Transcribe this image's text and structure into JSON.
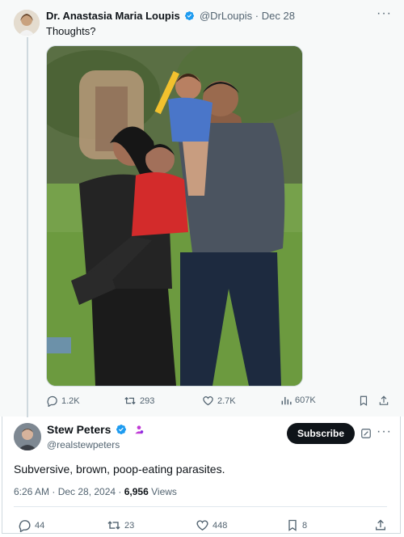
{
  "tweet_original": {
    "author_name": "Dr. Anastasia Maria Loupis",
    "handle": "@DrLoupis",
    "separator": "·",
    "date": "Dec 28",
    "text": "Thoughts?",
    "stats": {
      "replies": "1.2K",
      "retweets": "293",
      "likes": "2.7K",
      "views": "607K"
    }
  },
  "tweet_quote": {
    "author_name": "Stew Peters",
    "handle": "@realstewpeters",
    "subscribe_label": "Subscribe",
    "text": "Subversive, brown, poop-eating parasites.",
    "timestamp": "6:26 AM · Dec 28, 2024 · ",
    "views_count": "6,956",
    "views_label": " Views",
    "stats": {
      "replies": "44",
      "retweets": "23",
      "likes": "448",
      "bookmarks": "8"
    }
  },
  "colors": {
    "verified": "#1d9bf0",
    "muted": "#536471",
    "text": "#0f1419"
  },
  "icons": [
    "verified-badge-icon",
    "more-icon",
    "reply-icon",
    "retweet-icon",
    "like-icon",
    "views-icon",
    "bookmark-icon",
    "share-icon",
    "grok-icon",
    "affiliate-badge-icon"
  ]
}
